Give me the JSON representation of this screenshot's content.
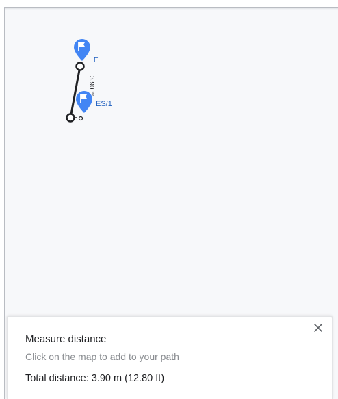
{
  "map": {
    "markers": [
      {
        "label": "E",
        "icon": "flag-pin-icon",
        "color": "#4285f4"
      },
      {
        "label": "ES/1",
        "icon": "flag-pin-icon",
        "color": "#4285f4"
      }
    ],
    "measure_line": {
      "label": "3.90 m",
      "color": "#202124"
    }
  },
  "panel": {
    "title": "Measure distance",
    "hint": "Click on the map to add to your path",
    "total": "Total distance: 3.90 m (12.80 ft)",
    "close_icon": "close-icon"
  }
}
